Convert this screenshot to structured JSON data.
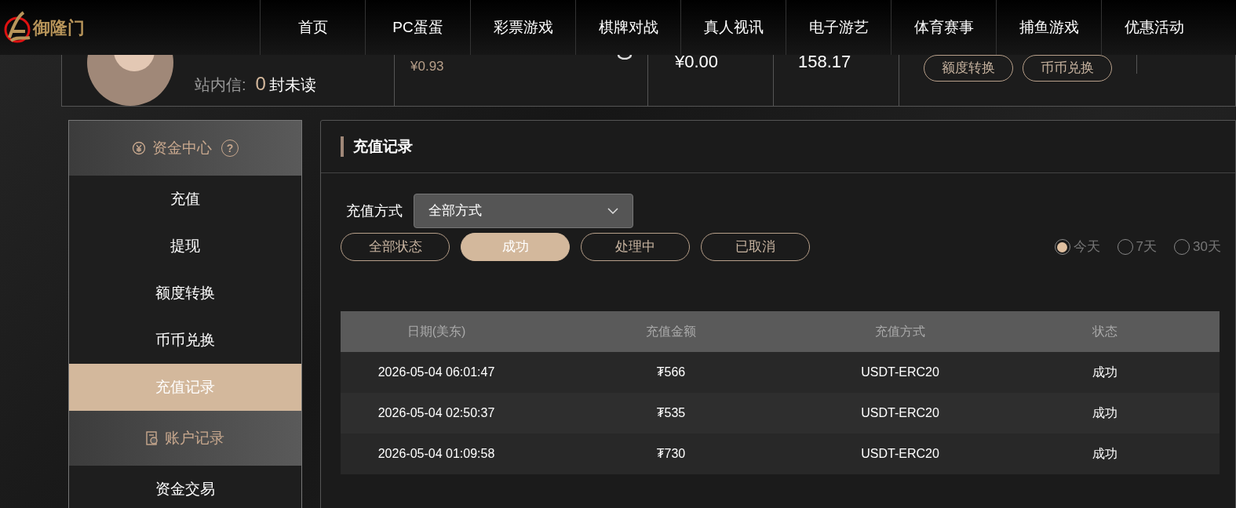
{
  "logo_text": "御隆门",
  "nav": {
    "items": [
      {
        "label": "首页",
        "selected": false
      },
      {
        "label": "PC蛋蛋",
        "selected": false
      },
      {
        "label": "彩票游戏",
        "selected": false
      },
      {
        "label": "棋牌对战",
        "selected": false
      },
      {
        "label": "真人视讯",
        "selected": false
      },
      {
        "label": "电子游艺",
        "selected": false
      },
      {
        "label": "体育赛事",
        "selected": false
      },
      {
        "label": "捕鱼游戏",
        "selected": false
      },
      {
        "label": "优惠活动",
        "selected": false
      }
    ]
  },
  "profile": {
    "messages_label": "站内信:",
    "unread_count": "0",
    "unread_suffix": "封未读",
    "balance_1": "¥0.93",
    "balance_2": "¥0.00",
    "balance_3": "158.17",
    "buttons": [
      "额度转换",
      "币币兑换"
    ]
  },
  "sidebar": {
    "groups": [
      {
        "title": "资金中心",
        "help": "?",
        "items": [
          {
            "label": "充值",
            "selected": false
          },
          {
            "label": "提现",
            "selected": false
          },
          {
            "label": "额度转换",
            "selected": false
          },
          {
            "label": "币币兑换",
            "selected": false
          },
          {
            "label": "充值记录",
            "selected": true
          }
        ]
      },
      {
        "title": "账户记录",
        "items": [
          {
            "label": "资金交易",
            "selected": false
          }
        ]
      }
    ]
  },
  "main": {
    "title": "充值记录",
    "method_label": "充值方式",
    "method_value": "全部方式",
    "status_filters": [
      {
        "label": "全部状态",
        "selected": false
      },
      {
        "label": "成功",
        "selected": true
      },
      {
        "label": "处理中",
        "selected": false
      },
      {
        "label": "已取消",
        "selected": false
      }
    ],
    "ranges": [
      {
        "label": "今天",
        "selected": true
      },
      {
        "label": "7天",
        "selected": false
      },
      {
        "label": "30天",
        "selected": false
      }
    ],
    "table": {
      "columns": [
        "日期(美东)",
        "充值金额",
        "充值方式",
        "状态"
      ],
      "rows": [
        [
          "2026-05-04 06:01:47",
          "₮566",
          "USDT-ERC20",
          "成功"
        ],
        [
          "2026-05-04 02:50:37",
          "₮535",
          "USDT-ERC20",
          "成功"
        ],
        [
          "2026-05-04 01:09:58",
          "₮730",
          "USDT-ERC20",
          "成功"
        ]
      ]
    }
  }
}
